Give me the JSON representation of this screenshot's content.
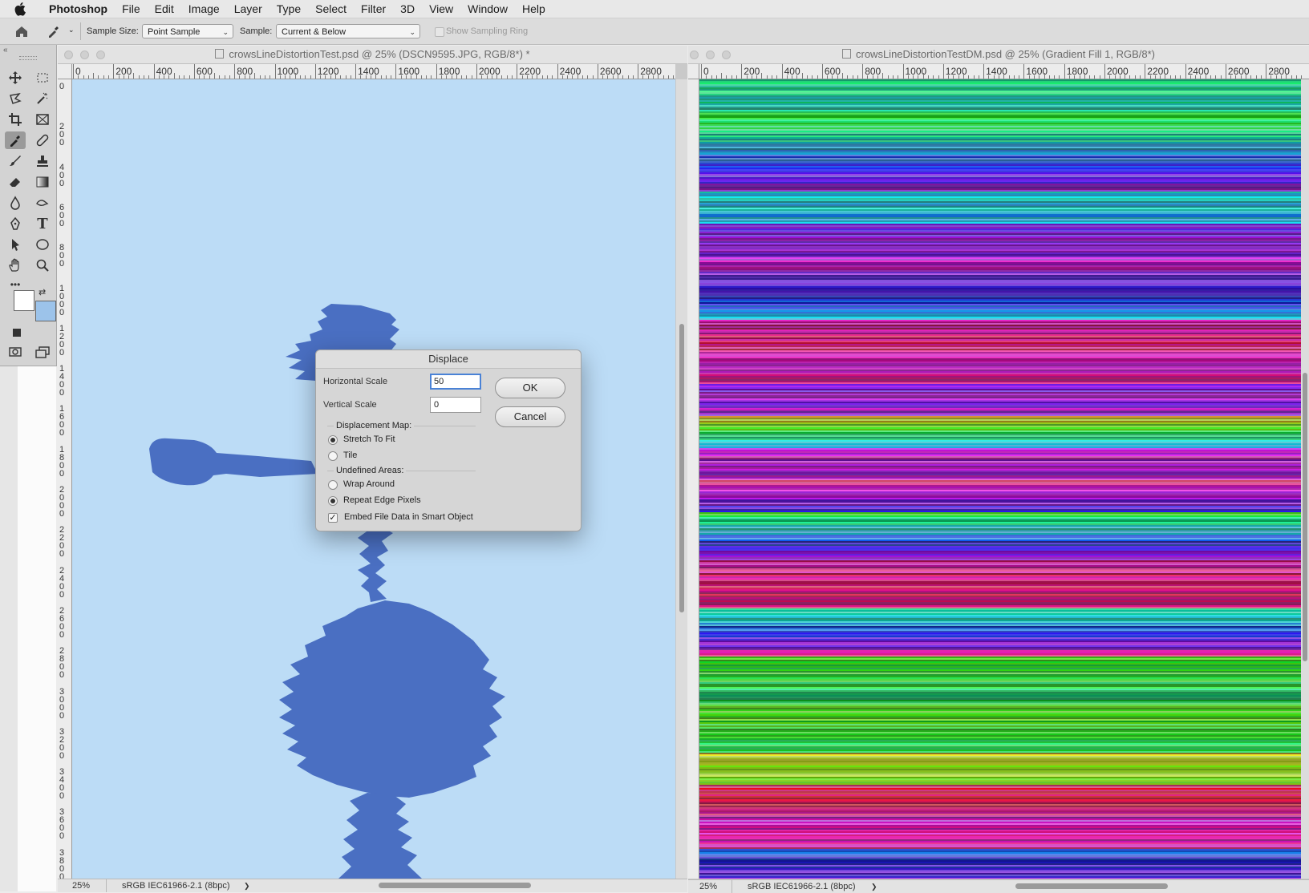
{
  "menubar": {
    "app": "Photoshop",
    "items": [
      "File",
      "Edit",
      "Image",
      "Layer",
      "Type",
      "Select",
      "Filter",
      "3D",
      "View",
      "Window",
      "Help"
    ]
  },
  "options_bar": {
    "sample_size_label": "Sample Size:",
    "sample_size_value": "Point Sample",
    "sample_label": "Sample:",
    "sample_value": "Current & Below",
    "show_ring_label": "Show Sampling Ring"
  },
  "toolbar": {
    "tools": [
      "move-icon",
      "marquee-icon",
      "lasso-icon",
      "magic-wand-icon",
      "crop-icon",
      "frame-icon",
      "eyedropper-icon",
      "healing-icon",
      "brush-icon",
      "stamp-icon",
      "eraser-icon",
      "gradient-icon",
      "blur-icon",
      "smudge-icon",
      "pen-icon",
      "type-icon",
      "path-select-icon",
      "ellipse-icon",
      "hand-icon",
      "zoom-icon",
      "more-icon"
    ],
    "type_glyph": "T",
    "more_glyph": "•••",
    "foreground_color": "#ffffff",
    "background_color": "#9cc3ea"
  },
  "doc_left": {
    "title": "crowsLineDistortionTest.psd @ 25% (DSCN9595.JPG, RGB/8*) *",
    "ruler_labels": [
      "0",
      "200",
      "400",
      "600",
      "800",
      "1000",
      "1200",
      "1400",
      "1600",
      "1800",
      "2000",
      "2200",
      "2400",
      "2600",
      "2800"
    ],
    "vruler_labels": [
      "0",
      "200",
      "400",
      "600",
      "800",
      "1000",
      "1200",
      "1400",
      "1600",
      "1800",
      "2000",
      "2200",
      "2400",
      "2600",
      "2800",
      "3000",
      "3200",
      "3400",
      "3600",
      "3800"
    ],
    "zoom": "25%",
    "profile": "sRGB IEC61966-2.1 (8bpc)",
    "arrow": "❯"
  },
  "doc_right": {
    "title": "crowsLineDistortionTestDM.psd @ 25% (Gradient Fill 1, RGB/8*)",
    "ruler_labels": [
      "0",
      "200",
      "400",
      "600",
      "800",
      "1000",
      "1200",
      "1400",
      "1600",
      "1800",
      "2000",
      "2200",
      "2400",
      "2600",
      "2800"
    ],
    "zoom": "25%",
    "profile": "sRGB IEC61966-2.1 (8bpc)",
    "arrow": "❯"
  },
  "dialog": {
    "title": "Displace",
    "horizontal_label": "Horizontal Scale",
    "horizontal_value": "50",
    "vertical_label": "Vertical Scale",
    "vertical_value": "0",
    "ok": "OK",
    "cancel": "Cancel",
    "map_group": "Displacement Map:",
    "stretch": "Stretch To Fit",
    "tile": "Tile",
    "undefined_group": "Undefined Areas:",
    "wrap": "Wrap Around",
    "repeat": "Repeat Edge Pixels",
    "embed": "Embed File Data in Smart Object",
    "check_glyph": "✓"
  },
  "colors": {
    "canvas_bg": "#bcdcf6",
    "figure": "#4a6fc2"
  }
}
